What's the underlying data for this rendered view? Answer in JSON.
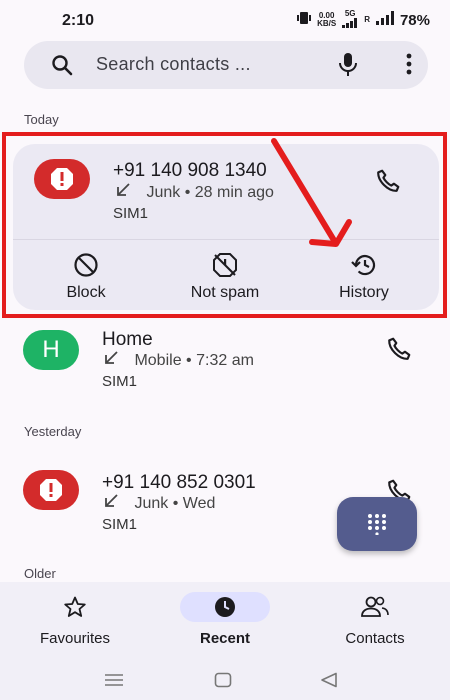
{
  "status_bar": {
    "time": "2:10",
    "net_speed_value": "0.00",
    "net_speed_unit": "KB/S",
    "network_5g": "5G",
    "network_r": "R",
    "battery": "78%"
  },
  "search": {
    "placeholder": "Search contacts ..."
  },
  "sections": {
    "today": "Today",
    "yesterday": "Yesterday",
    "older": "Older"
  },
  "calls": [
    {
      "number": "+91 140 908 1340",
      "type": "Junk",
      "time": "28 min ago",
      "sim": "SIM1",
      "sep": "•"
    },
    {
      "avatar_letter": "H",
      "name": "Home",
      "type": "Mobile",
      "time": "7:32 am",
      "sim": "SIM1",
      "sep": "•"
    },
    {
      "number": "+91 140 852 0301",
      "type": "Junk",
      "time": "Wed",
      "sim": "SIM1",
      "sep": "•"
    }
  ],
  "actions": {
    "block": "Block",
    "not_spam": "Not spam",
    "history": "History"
  },
  "bottom_nav": {
    "favourites": "Favourites",
    "recent": "Recent",
    "contacts": "Contacts"
  },
  "colors": {
    "annotation_red": "#e41d1d",
    "junk_avatar": "#d32b2b",
    "contact_avatar": "#1eb365",
    "fab": "#545c8e"
  },
  "icons": [
    "search-icon",
    "mic-icon",
    "more-vert-icon",
    "spam-icon",
    "phone-icon",
    "block-icon",
    "not-spam-icon",
    "history-icon",
    "dialpad-icon",
    "star-icon",
    "clock-icon",
    "contacts-icon"
  ]
}
